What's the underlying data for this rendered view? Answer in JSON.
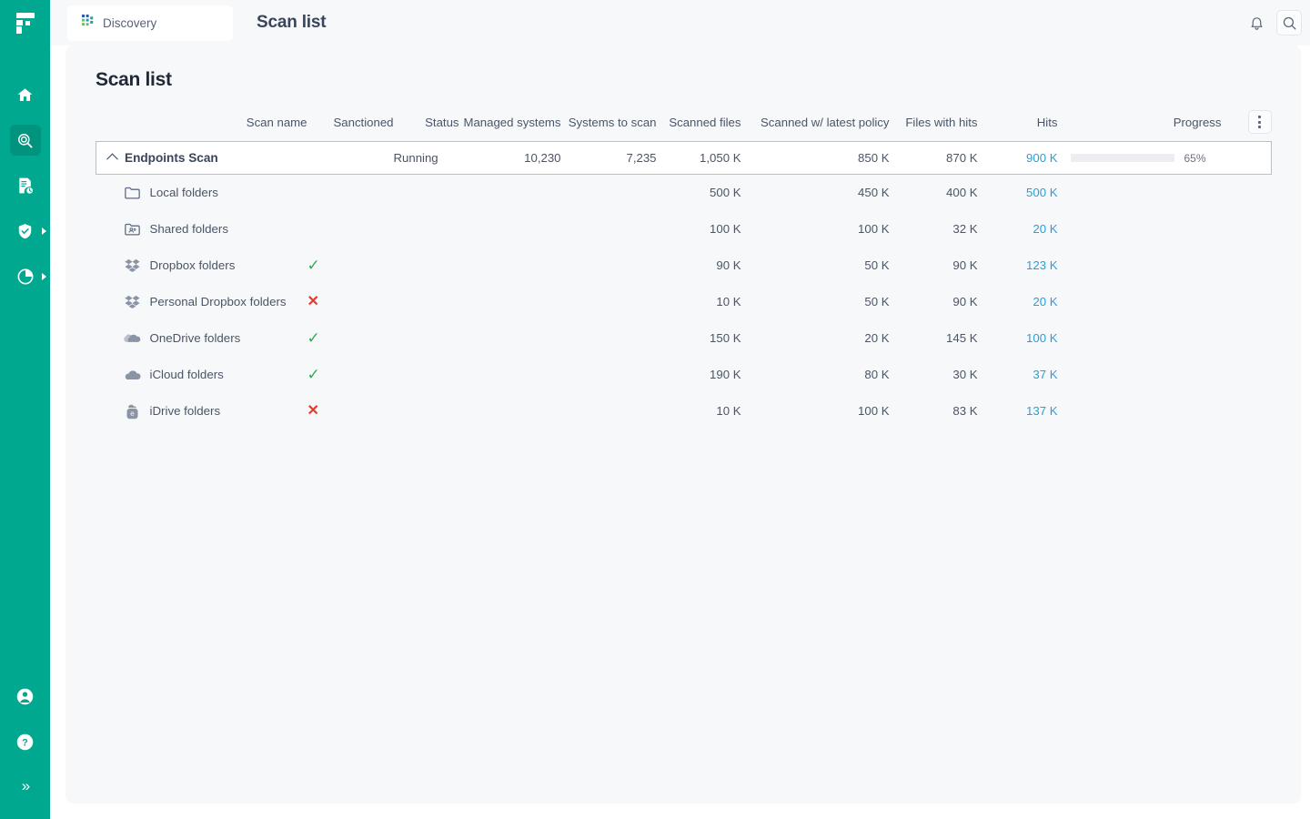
{
  "brand": {
    "logo_letter": "F",
    "color": "#00a88f"
  },
  "sidebar": {
    "items": [
      {
        "name": "home",
        "icon": "home-icon",
        "active": false,
        "expandable": false
      },
      {
        "name": "discovery",
        "icon": "scan-search-icon",
        "active": true,
        "expandable": false
      },
      {
        "name": "reports",
        "icon": "document-clock-icon",
        "active": false,
        "expandable": false
      },
      {
        "name": "protection",
        "icon": "shield-check-icon",
        "active": false,
        "expandable": true
      },
      {
        "name": "analytics",
        "icon": "pie-chart-icon",
        "active": false,
        "expandable": true
      }
    ],
    "bottom_items": [
      {
        "name": "account",
        "icon": "user-circle-icon"
      },
      {
        "name": "help",
        "icon": "question-circle-icon"
      }
    ],
    "collapse_glyph": "»"
  },
  "topbar": {
    "tab_label": "Discovery",
    "tab_icon": "dots-grid-icon",
    "title": "Scan list",
    "notifications_icon": "bell-icon",
    "search_icon": "search-icon"
  },
  "page": {
    "title": "Scan list"
  },
  "table": {
    "columns": [
      {
        "key": "name",
        "label": "Scan name"
      },
      {
        "key": "sanctioned",
        "label": "Sanctioned"
      },
      {
        "key": "status",
        "label": "Status"
      },
      {
        "key": "managed_systems",
        "label": "Managed systems"
      },
      {
        "key": "systems_to_scan",
        "label": "Systems to scan"
      },
      {
        "key": "scanned_files",
        "label": "Scanned files"
      },
      {
        "key": "scanned_latest_policy",
        "label": "Scanned w/ latest policy"
      },
      {
        "key": "files_with_hits",
        "label": "Files with hits"
      },
      {
        "key": "hits",
        "label": "Hits"
      },
      {
        "key": "progress",
        "label": "Progress"
      }
    ],
    "menu_icon": "kebab-menu-icon",
    "parent_row": {
      "name": "Endpoints Scan",
      "expanded": true,
      "sanctioned": "",
      "status": "Running",
      "managed_systems": "10,230",
      "systems_to_scan": "7,235",
      "scanned_files": "1,050 K",
      "scanned_latest_policy": "850 K",
      "files_with_hits": "870 K",
      "hits": "900 K",
      "progress_percent": 65,
      "progress_label": "65%"
    },
    "child_rows": [
      {
        "name": "Local folders",
        "icon": "folder-icon",
        "sanctioned": null,
        "scanned_files": "500 K",
        "scanned_latest_policy": "450 K",
        "files_with_hits": "400 K",
        "hits": "500 K"
      },
      {
        "name": "Shared folders",
        "icon": "shared-folder-icon",
        "sanctioned": null,
        "scanned_files": "100 K",
        "scanned_latest_policy": "100 K",
        "files_with_hits": "32 K",
        "hits": "20 K"
      },
      {
        "name": "Dropbox folders",
        "icon": "dropbox-icon",
        "sanctioned": "yes",
        "scanned_files": "90 K",
        "scanned_latest_policy": "50 K",
        "files_with_hits": "90 K",
        "hits": "123 K"
      },
      {
        "name": "Personal Dropbox folders",
        "icon": "dropbox-icon",
        "sanctioned": "no",
        "scanned_files": "10 K",
        "scanned_latest_policy": "50 K",
        "files_with_hits": "90 K",
        "hits": "20 K"
      },
      {
        "name": "OneDrive folders",
        "icon": "onedrive-icon",
        "sanctioned": "yes",
        "scanned_files": "150 K",
        "scanned_latest_policy": "20 K",
        "files_with_hits": "145 K",
        "hits": "100 K"
      },
      {
        "name": "iCloud folders",
        "icon": "icloud-icon",
        "sanctioned": "yes",
        "scanned_files": "190 K",
        "scanned_latest_policy": "80 K",
        "files_with_hits": "30 K",
        "hits": "37 K"
      },
      {
        "name": "iDrive folders",
        "icon": "idrive-icon",
        "sanctioned": "no",
        "scanned_files": "10 K",
        "scanned_latest_policy": "100 K",
        "files_with_hits": "83 K",
        "hits": "137 K"
      }
    ]
  },
  "colors": {
    "sidebar": "#00a88f",
    "selected_row_border": "#8fd6cb",
    "link": "#2a9fd6",
    "yes": "#34a853",
    "no": "#e8392b"
  },
  "marks": {
    "yes": "✓",
    "no": "✕"
  }
}
